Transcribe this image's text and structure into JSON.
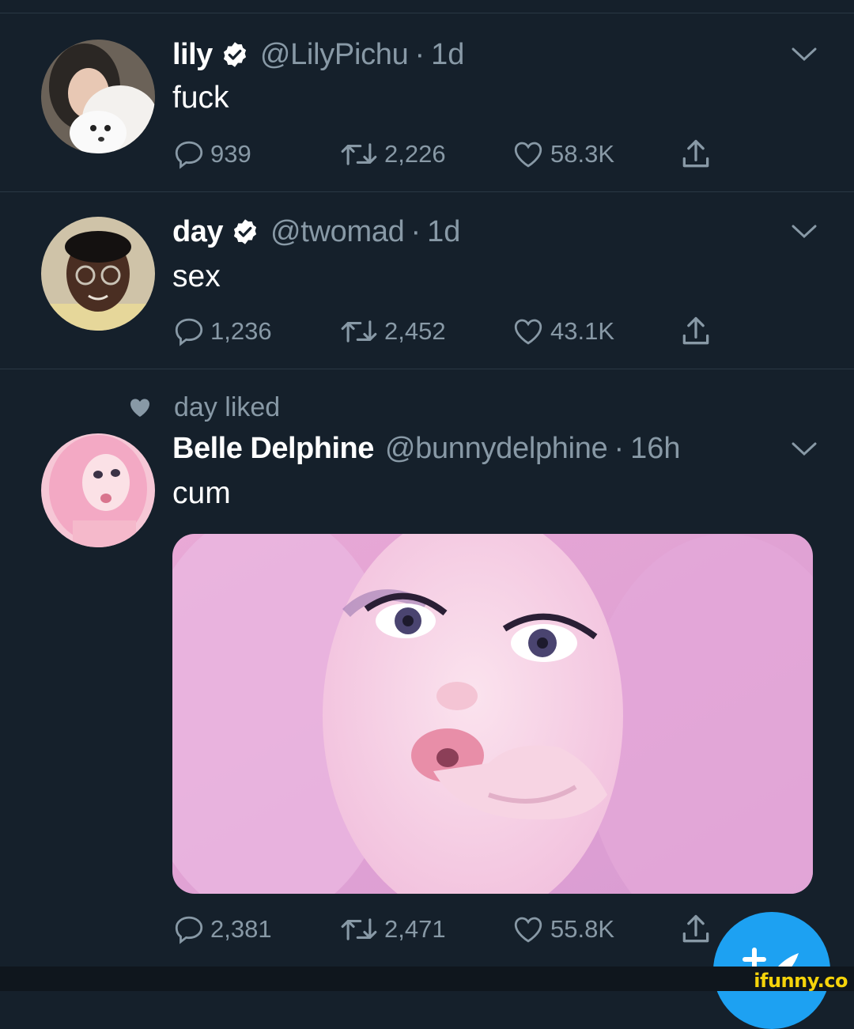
{
  "colors": {
    "background": "#15202b",
    "secondary_text": "#8899a6",
    "accent": "#1da1f2",
    "separator": "#2a3844"
  },
  "tweets": [
    {
      "name": "lily",
      "handle": "@LilyPichu",
      "time": "1d",
      "text": "fuck",
      "verified": true,
      "replies": "939",
      "retweets": "2,226",
      "likes": "58.3K"
    },
    {
      "name": "day",
      "handle": "@twomad",
      "time": "1d",
      "text": "sex",
      "verified": true,
      "replies": "1,236",
      "retweets": "2,452",
      "likes": "43.1K"
    },
    {
      "social_context": "day liked",
      "name": "Belle Delphine",
      "handle": "@bunnydelphine",
      "time": "16h",
      "text": "cum",
      "verified": false,
      "replies": "2,381",
      "retweets": "2,471",
      "likes": "55.8K"
    }
  ],
  "separator_dot": "·",
  "watermark": "ifunny.co"
}
